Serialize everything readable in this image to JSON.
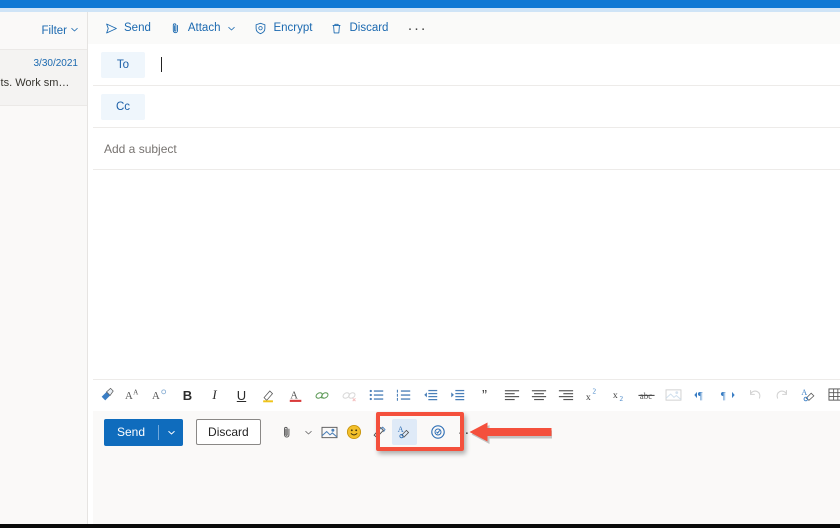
{
  "window": {
    "accent_color": "#0f78d4",
    "annotation_color": "#f4503c"
  },
  "command_bar": {
    "items": [
      {
        "label": "Send",
        "icon": "send-icon"
      },
      {
        "label": "Attach",
        "icon": "paperclip-icon",
        "has_chevron": true
      },
      {
        "label": "Encrypt",
        "icon": "shield-lock-icon"
      },
      {
        "label": "Discard",
        "icon": "trash-icon"
      }
    ],
    "overflow_label": "···"
  },
  "sidebar": {
    "filter_label": "Filter",
    "messages": [
      {
        "date": "3/30/2021",
        "snippet": "bits. Work sm…"
      }
    ]
  },
  "compose": {
    "to_label": "To",
    "cc_label": "Cc",
    "to_value": "",
    "cc_value": "",
    "subject_placeholder": "Add a subject",
    "subject_value": "",
    "body_value": ""
  },
  "format_toolbar": {
    "buttons": [
      {
        "name": "format-painter-icon",
        "title": "Format painter"
      },
      {
        "name": "grow-font-icon",
        "title": "Increase font size"
      },
      {
        "name": "shrink-font-icon",
        "title": "Decrease font size"
      },
      {
        "name": "bold-icon",
        "title": "Bold",
        "glyph": "B"
      },
      {
        "name": "italic-icon",
        "title": "Italic",
        "glyph": "I"
      },
      {
        "name": "underline-icon",
        "title": "Underline",
        "glyph": "U"
      },
      {
        "name": "highlight-icon",
        "title": "Text highlight color"
      },
      {
        "name": "font-color-icon",
        "title": "Font color"
      },
      {
        "name": "insert-link-icon",
        "title": "Insert link"
      },
      {
        "name": "remove-link-icon",
        "title": "Remove link"
      },
      {
        "name": "bulleted-list-icon",
        "title": "Bulleted list"
      },
      {
        "name": "numbered-list-icon",
        "title": "Numbered list"
      },
      {
        "name": "decrease-indent-icon",
        "title": "Decrease indent"
      },
      {
        "name": "increase-indent-icon",
        "title": "Increase indent"
      },
      {
        "name": "quote-icon",
        "title": "Quote",
        "glyph": "”"
      },
      {
        "name": "align-left-icon",
        "title": "Align left"
      },
      {
        "name": "align-center-icon",
        "title": "Align center"
      },
      {
        "name": "align-right-icon",
        "title": "Align right"
      },
      {
        "name": "superscript-icon",
        "title": "Superscript"
      },
      {
        "name": "subscript-icon",
        "title": "Subscript"
      },
      {
        "name": "strikethrough-icon",
        "title": "Strikethrough"
      },
      {
        "name": "insert-picture-icon",
        "title": "Insert picture inline"
      },
      {
        "name": "ltr-direction-icon",
        "title": "Left-to-right"
      },
      {
        "name": "rtl-direction-icon",
        "title": "Right-to-left"
      },
      {
        "name": "undo-icon",
        "title": "Undo"
      },
      {
        "name": "redo-icon",
        "title": "Redo"
      },
      {
        "name": "clear-formatting-icon",
        "title": "Remove formatting"
      },
      {
        "name": "insert-table-icon",
        "title": "Insert table"
      }
    ]
  },
  "action_bar": {
    "send_label": "Send",
    "discard_label": "Discard",
    "more_label": "···",
    "icons": [
      {
        "name": "attach-file-icon",
        "title": "Attach file"
      },
      {
        "name": "insert-picture-icon",
        "title": "Insert pictures inline"
      },
      {
        "name": "emoji-icon",
        "title": "Emoji"
      },
      {
        "name": "signature-icon",
        "title": "Insert signature"
      },
      {
        "name": "editor-icon",
        "title": "Editor",
        "active": true
      },
      {
        "name": "set-options-icon",
        "title": "Set options"
      }
    ]
  },
  "annotation": {
    "highlight_target": "set-options-and-more-group",
    "arrow_direction": "left"
  }
}
